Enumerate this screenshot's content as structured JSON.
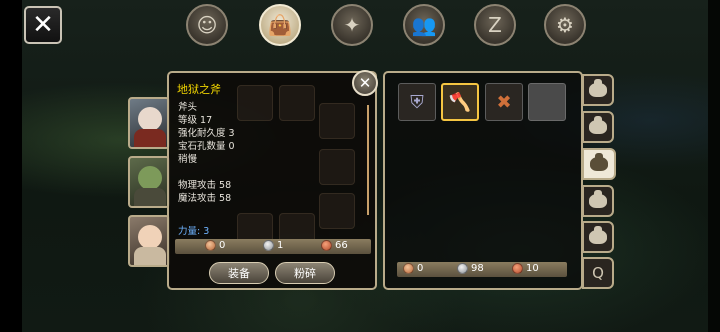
{
  "close_label": "✕",
  "top_nav": [
    {
      "name": "character-tab",
      "glyph": "☺"
    },
    {
      "name": "bag-tab",
      "glyph": "👜",
      "active": true
    },
    {
      "name": "skills-tab",
      "glyph": "✦"
    },
    {
      "name": "party-tab",
      "glyph": "👥"
    },
    {
      "name": "sleep-tab",
      "glyph": "Z"
    },
    {
      "name": "settings-tab",
      "glyph": "⚙"
    }
  ],
  "item": {
    "name": "地狱之斧",
    "close_label": "✕",
    "stats": [
      "斧头",
      "等级 17",
      "强化耐久度 3",
      "宝石孔数量 0",
      "稍慢"
    ],
    "attacks": [
      "物理攻击 58",
      "魔法攻击 58"
    ],
    "strength": "力量: 3",
    "cost": {
      "bronze": "0",
      "silver": "1",
      "copper": "66"
    },
    "equip_label": "装备",
    "shatter_label": "粉碎"
  },
  "inventory": {
    "slots": [
      {
        "icon": "armor-icon",
        "glyph": "⛨",
        "color": "#a9a9d0"
      },
      {
        "icon": "axe-icon",
        "glyph": "🪓",
        "color": "#e3b23c",
        "selected": true
      },
      {
        "icon": "vest-icon",
        "glyph": "✖",
        "color": "#d0703a"
      },
      {
        "icon": "empty-slot",
        "glyph": "",
        "empty": true
      }
    ],
    "currency": {
      "bronze": "0",
      "silver": "98",
      "copper": "10"
    }
  },
  "side_tabs": [
    {
      "name": "bag-1"
    },
    {
      "name": "bag-2"
    },
    {
      "name": "bag-3",
      "active": true
    },
    {
      "name": "bag-4"
    },
    {
      "name": "bag-5"
    },
    {
      "name": "bag-quest",
      "glyph": "Q"
    }
  ],
  "colors": {
    "item_name": "#f0d400",
    "strength": "#6fb4ff",
    "panel_border": "#b9ab8a",
    "selected_slot": "#f5c542"
  }
}
